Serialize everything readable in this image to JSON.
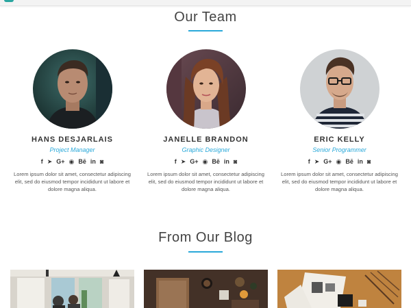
{
  "sections": {
    "team_title": "Our Team",
    "blog_title": "From Our Blog"
  },
  "team": [
    {
      "name": "HANS DESJARLAIS",
      "role": "Project Manager",
      "description": "Lorem ipsum dolor sit amet, consectetur adipiscing elit, sed do eiusmod tempor incididunt ut labore et dolore magna aliqua."
    },
    {
      "name": "JANELLE BRANDON",
      "role": "Graphic Designer",
      "description": "Lorem ipsum dolor sit amet, consectetur adipiscing elit, sed do eiusmod tempor incididunt ut labore et dolore magna aliqua."
    },
    {
      "name": "ERIC KELLY",
      "role": "Senior Programmer",
      "description": "Lorem ipsum dolor sit amet, consectetur adipiscing elit, sed do eiusmod tempor incididunt ut labore et dolore magna aliqua."
    }
  ],
  "social_icons": [
    "facebook-icon",
    "twitter-icon",
    "google-plus-icon",
    "github-icon",
    "behance-icon",
    "linkedin-icon",
    "instagram-icon"
  ],
  "social_glyphs": {
    "facebook": "f",
    "twitter": "🐦",
    "google_plus": "G+",
    "github": "◉",
    "behance": "Bē",
    "linkedin": "in",
    "instagram": "◙"
  },
  "colors": {
    "accent": "#29a8d9",
    "topbar_accent": "#2aa6a0",
    "heading": "#444444",
    "body_text": "#555555"
  },
  "blog_images": [
    "cafe-interior-photo",
    "desk-flatlay-photo",
    "magazine-table-photo"
  ]
}
